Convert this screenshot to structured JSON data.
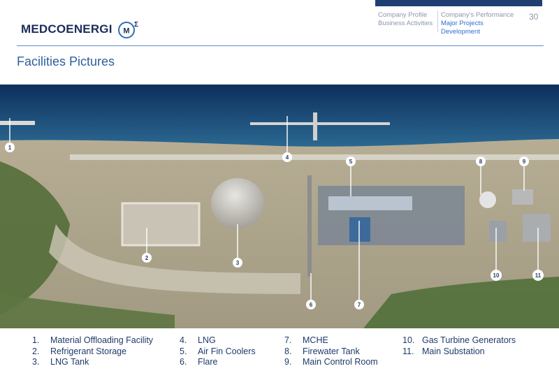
{
  "header": {
    "company_name": "MedcoEnergi",
    "nav_left": [
      "Company Profile",
      "Business Activities"
    ],
    "nav_right": [
      "Company's Performance",
      "Major Projects Development"
    ],
    "page_number": "30"
  },
  "page_title": "Facilities Pictures",
  "photo": {
    "markers": [
      "1",
      "2",
      "3",
      "4",
      "5",
      "6",
      "7",
      "8",
      "9",
      "10",
      "11"
    ]
  },
  "legend": [
    {
      "num": "1.",
      "label": "Material Offloading Facility"
    },
    {
      "num": "2.",
      "label": "Refrigerant Storage"
    },
    {
      "num": "3.",
      "label": "LNG Tank"
    },
    {
      "num": "4.",
      "label": "LNG"
    },
    {
      "num": "5.",
      "label": "Air Fin Coolers"
    },
    {
      "num": "6.",
      "label": "Flare"
    },
    {
      "num": "7.",
      "label": "MCHE"
    },
    {
      "num": "8.",
      "label": "Firewater Tank"
    },
    {
      "num": "9.",
      "label": "Main Control Room"
    },
    {
      "num": "10.",
      "label": "Gas Turbine Generators"
    },
    {
      "num": "11.",
      "label": "Main Substation"
    }
  ],
  "colors": {
    "brand_navy": "#1c2d5a",
    "accent_blue": "#2f6fcf",
    "title_blue": "#2e5f9e",
    "rule_blue": "#5b8fc9"
  }
}
